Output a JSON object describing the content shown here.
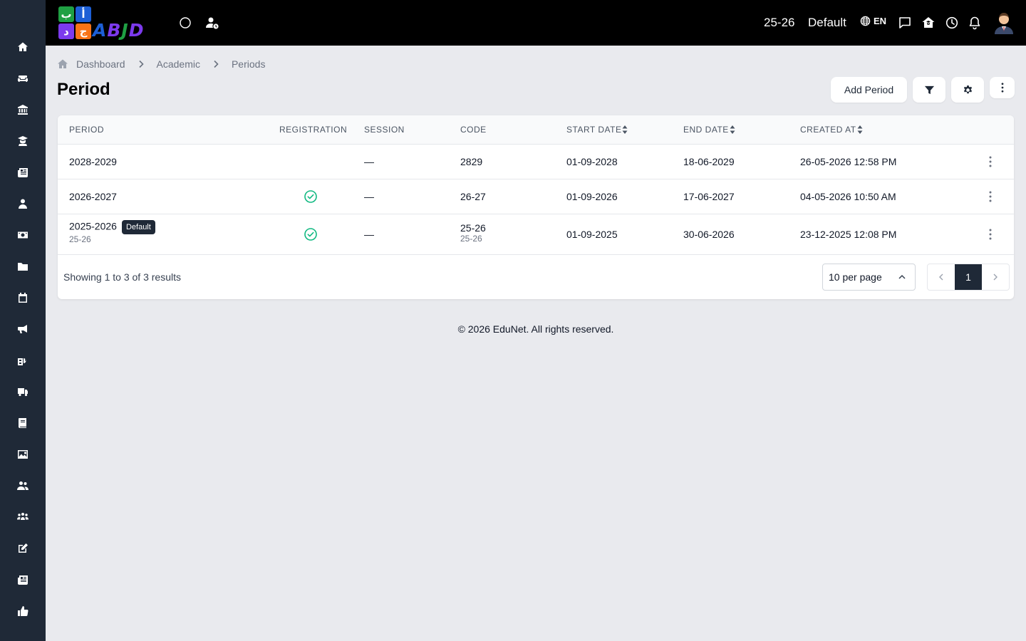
{
  "logo": {
    "tiles": [
      "ب",
      "أ",
      "د",
      "ج"
    ],
    "word": "ABJD",
    "colors": {
      "green": "#1fa043",
      "blue": "#1d5fd6",
      "purple": "#7c3aed",
      "orange": "#f97316"
    }
  },
  "header": {
    "period": "25-26",
    "session": "Default",
    "language": "EN"
  },
  "sidebar": {
    "icons": [
      "home-icon",
      "sofa-icon",
      "institution-icon",
      "graduate-icon",
      "newspaper-icon",
      "user-icon",
      "money-icon",
      "folder-icon",
      "calendar-icon",
      "megaphone-icon",
      "school-icon",
      "truck-icon",
      "book-icon",
      "image-icon",
      "users-icon",
      "group-icon",
      "edit-icon",
      "news-icon",
      "thumbs-up-icon"
    ]
  },
  "breadcrumb": {
    "items": [
      "Dashboard",
      "Academic",
      "Periods"
    ]
  },
  "page": {
    "title": "Period",
    "add_button": "Add Period"
  },
  "table": {
    "columns": [
      "PERIOD",
      "REGISTRATION",
      "SESSION",
      "CODE",
      "START DATE",
      "END DATE",
      "CREATED AT"
    ],
    "rows": [
      {
        "period": "2028-2029",
        "period_sub": "",
        "badge": "",
        "registration": false,
        "session": "—",
        "code": "2829",
        "code_sub": "",
        "start": "01-09-2028",
        "end": "18-06-2029",
        "created": "26-05-2026 12:58 PM"
      },
      {
        "period": "2026-2027",
        "period_sub": "",
        "badge": "",
        "registration": true,
        "session": "—",
        "code": "26-27",
        "code_sub": "",
        "start": "01-09-2026",
        "end": "17-06-2027",
        "created": "04-05-2026 10:50 AM"
      },
      {
        "period": "2025-2026",
        "period_sub": "25-26",
        "badge": "Default",
        "registration": true,
        "session": "—",
        "code": "25-26",
        "code_sub": "25-26",
        "start": "01-09-2025",
        "end": "30-06-2026",
        "created": "23-12-2025 12:08 PM"
      }
    ]
  },
  "pagination": {
    "showing": "Showing 1 to 3 of 3 results",
    "per_page": "10 per page",
    "current_page": "1"
  },
  "footer": {
    "text": "© 2026 EduNet. All rights reserved."
  },
  "colors": {
    "sidebar": "#1f2937",
    "topbar": "#000000",
    "background": "#e9eaee",
    "check": "#10b981"
  }
}
